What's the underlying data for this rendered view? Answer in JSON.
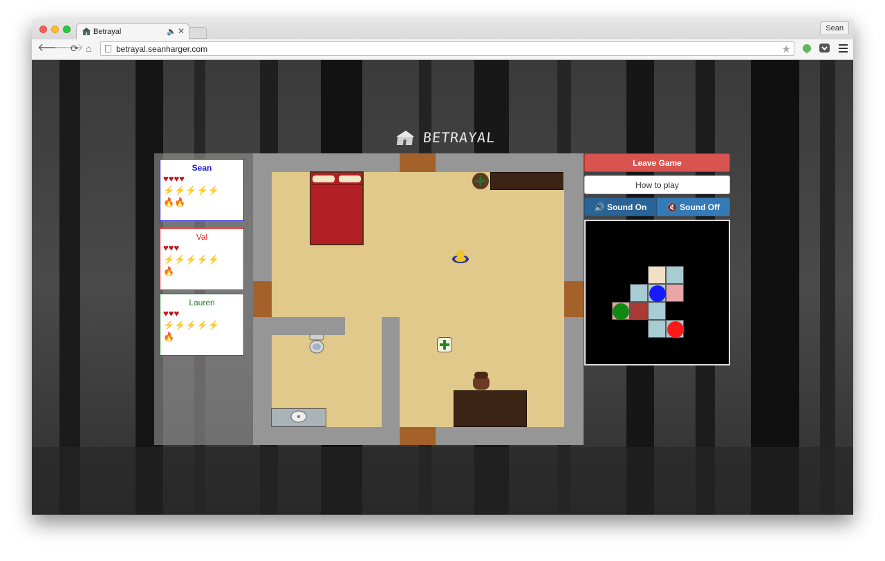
{
  "browser": {
    "tab_title": "Betrayal",
    "tab_audio": "🔈",
    "tab_close": "✕",
    "profile_name": "Sean",
    "url": "betrayal.seanharger.com",
    "star": "★"
  },
  "game": {
    "logo": "BETRAYAL",
    "players": [
      {
        "name": "Sean",
        "color": "#1a1ad6",
        "hearts": "♥♥♥♥",
        "bolts": "⚡⚡⚡⚡⚡",
        "flames": "🔥🔥"
      },
      {
        "name": "Val",
        "color": "#e02020",
        "hearts": "♥♥♥",
        "bolts": "⚡⚡⚡⚡⚡",
        "flames": "🔥"
      },
      {
        "name": "Lauren",
        "color": "#1e7a1e",
        "hearts": "♥♥♥",
        "bolts": "⚡⚡⚡⚡⚡",
        "flames": "🔥"
      }
    ],
    "buttons": {
      "leave": "Leave Game",
      "how_to_play": "How to play",
      "sound_on": "🔊 Sound On",
      "sound_off": "🔇 Sound Off"
    },
    "minimap": {
      "tokens": [
        {
          "name": "blue",
          "color": "#1a1aff"
        },
        {
          "name": "green",
          "color": "#118811"
        },
        {
          "name": "red",
          "color": "#ff1a1a"
        }
      ]
    }
  }
}
